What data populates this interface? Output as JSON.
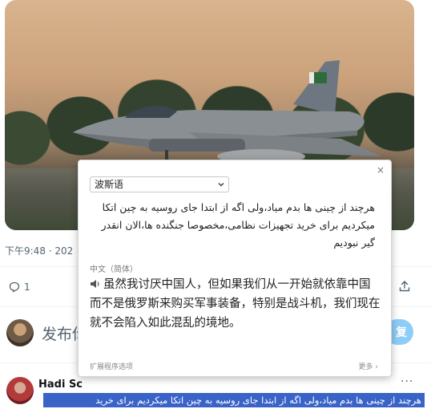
{
  "tweet": {
    "timestamp": "下午9:48 · 202",
    "reply_count": "1",
    "composer_placeholder": "发布你",
    "reply_button_label": "复"
  },
  "reply": {
    "author_name": "Hadi Sc",
    "author_handle": "",
    "more_label": "···",
    "text": "هرچند از چینی ها بدم میاد،ولی اگه از ابتدا جای روسیه به چین اتکا میکردیم برای خرید"
  },
  "translation_popup": {
    "close_label": "×",
    "source_language": "波斯语",
    "source_text_lines": [
      "هرچند از چینی ها بدم میاد،ولی اگه از ابتدا جای روسیه به چین اتکا",
      "میکردیم برای خرید تجهیزات نظامی،مخصوصا جنگنده ها،الان انقدر",
      "گیر نبودیم"
    ],
    "target_language": "中文（简体）",
    "translated_text": "虽然我讨厌中国人，但如果我们从一开始就依靠中国而不是俄罗斯来购买军事装备，特别是战斗机，我们现在就不会陷入如此混乱的境地。",
    "footer_left": "扩展程序选项",
    "footer_right": "更多 ›"
  },
  "colors": {
    "accent_blue": "#1d9bf0",
    "selection_blue": "#3a63c8",
    "muted_text": "#536471"
  }
}
